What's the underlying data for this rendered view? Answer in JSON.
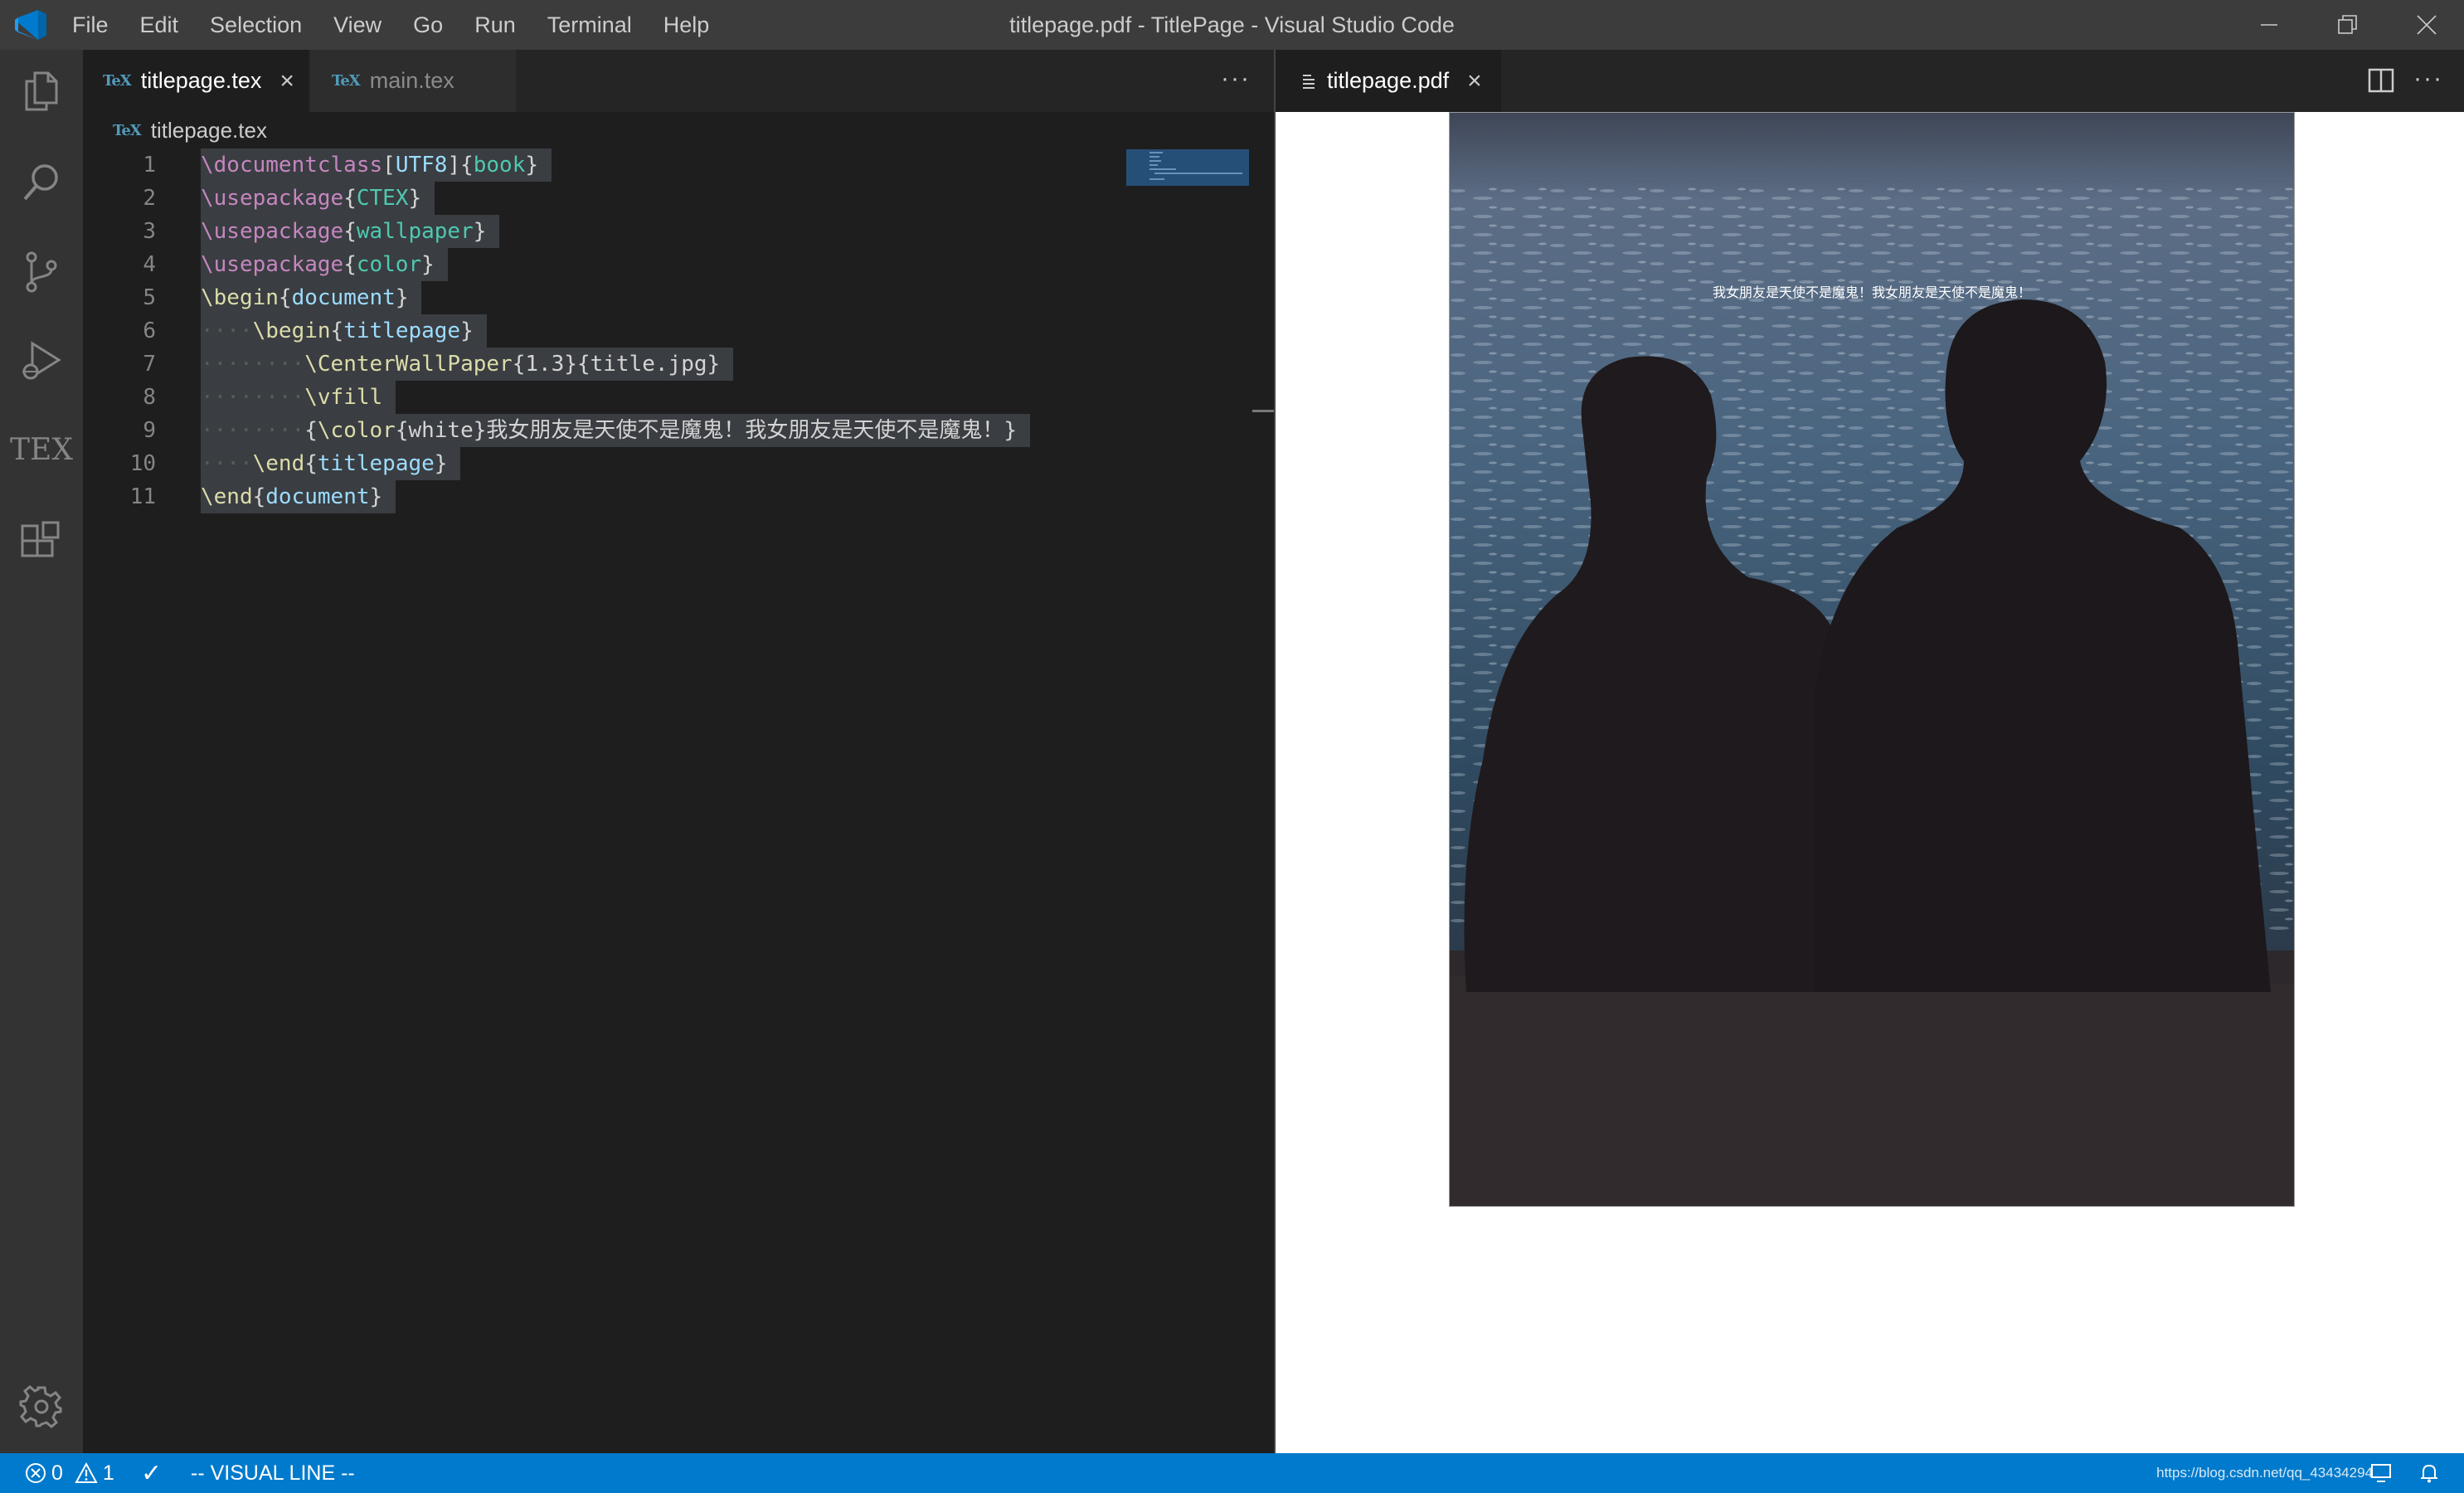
{
  "window": {
    "title": "titlepage.pdf - TitlePage - Visual Studio Code"
  },
  "menu": [
    "File",
    "Edit",
    "Selection",
    "View",
    "Go",
    "Run",
    "Terminal",
    "Help"
  ],
  "activity_bar": {
    "items": [
      "files-icon",
      "search-icon",
      "source-control-icon",
      "run-debug-icon",
      "tex-icon",
      "extensions-icon"
    ],
    "tex_label": "TEX",
    "bottom": "gear-icon"
  },
  "editor_left": {
    "tabs": [
      {
        "label": "titlepage.tex",
        "badge": "TeX",
        "active": true
      },
      {
        "label": "main.tex",
        "badge": "TeX",
        "active": false
      }
    ],
    "more": "···",
    "breadcrumb": {
      "badge": "TeX",
      "label": "titlepage.tex"
    }
  },
  "code": {
    "line_numbers": [
      "1",
      "2",
      "3",
      "4",
      "5",
      "6",
      "7",
      "8",
      "9",
      "10",
      "11"
    ],
    "l1": {
      "cmd": "\\documentclass",
      "ob": "[",
      "opt": "UTF8",
      "cb": "]",
      "oc": "{",
      "arg": "book",
      "cc": "}"
    },
    "l2": {
      "cmd": "\\usepackage",
      "oc": "{",
      "arg": "CTEX",
      "cc": "}"
    },
    "l3": {
      "cmd": "\\usepackage",
      "oc": "{",
      "arg": "wallpaper",
      "cc": "}"
    },
    "l4": {
      "cmd": "\\usepackage",
      "oc": "{",
      "arg": "color",
      "cc": "}"
    },
    "l5": {
      "cmd": "\\begin",
      "oc": "{",
      "arg": "document",
      "cc": "}"
    },
    "l6": {
      "ws": "····",
      "cmd": "\\begin",
      "oc": "{",
      "arg": "titlepage",
      "cc": "}"
    },
    "l7": {
      "ws": "········",
      "cmd": "\\CenterWallPaper",
      "p1": "{1.3}",
      "p2": "{title.jpg}"
    },
    "l8": {
      "ws": "········",
      "cmd": "\\vfill"
    },
    "l9": {
      "ws": "········",
      "ob": "{",
      "cmd": "\\color",
      "oc": "{",
      "arg": "white",
      "cc": "}",
      "text": "我女朋友是天使不是魔鬼！我女朋友是天使不是魔鬼！",
      "cb": "}"
    },
    "l10": {
      "ws": "····",
      "cmd": "\\end",
      "oc": "{",
      "arg": "titlepage",
      "cc": "}"
    },
    "l11": {
      "cmd": "\\end",
      "oc": "{",
      "arg": "document",
      "cc": "}"
    }
  },
  "editor_right": {
    "tab": {
      "label": "titlepage.pdf"
    },
    "more": "···",
    "pdf_caption": "我女朋友是天使不是魔鬼！我女朋友是天使不是魔鬼！"
  },
  "statusbar": {
    "errors": "0",
    "warnings": "1",
    "check": "✓",
    "mode": "-- VISUAL LINE --",
    "watermark": "https://blog.csdn.net/qq_43434294"
  },
  "colors": {
    "accent": "#007acc",
    "titlebar": "#3c3c3c",
    "activitybar": "#333333",
    "editor_bg": "#1e1e1e",
    "selection": "#3a3d41"
  }
}
